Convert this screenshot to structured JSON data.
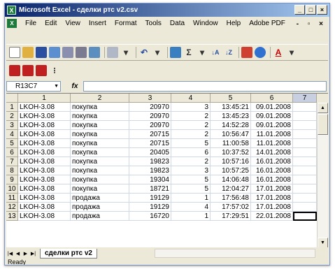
{
  "window": {
    "title": "Microsoft Excel - сделки ртс v2.csv",
    "controls": [
      "_",
      "□",
      "×"
    ]
  },
  "menu": {
    "items": [
      "File",
      "Edit",
      "View",
      "Insert",
      "Format",
      "Tools",
      "Data",
      "Window",
      "Help",
      "Adobe PDF"
    ]
  },
  "formula_bar": {
    "name_box": "R13C7",
    "fx_label": "fx",
    "content": ""
  },
  "columns": [
    "1",
    "2",
    "3",
    "4",
    "5",
    "6",
    "7"
  ],
  "rows": [
    {
      "n": "1",
      "c1": "LKOH-3.08",
      "c2": "покупка",
      "c3": "20970",
      "c4": "3",
      "c5": "13:45:21",
      "c6": "09.01.2008"
    },
    {
      "n": "2",
      "c1": "LKOH-3.08",
      "c2": "покупка",
      "c3": "20970",
      "c4": "2",
      "c5": "13:45:23",
      "c6": "09.01.2008"
    },
    {
      "n": "3",
      "c1": "LKOH-3.08",
      "c2": "покупка",
      "c3": "20970",
      "c4": "2",
      "c5": "14:52:28",
      "c6": "09.01.2008"
    },
    {
      "n": "4",
      "c1": "LKOH-3.08",
      "c2": "покупка",
      "c3": "20715",
      "c4": "2",
      "c5": "10:56:47",
      "c6": "11.01.2008"
    },
    {
      "n": "5",
      "c1": "LKOH-3.08",
      "c2": "покупка",
      "c3": "20715",
      "c4": "5",
      "c5": "11:00:58",
      "c6": "11.01.2008"
    },
    {
      "n": "6",
      "c1": "LKOH-3.08",
      "c2": "покупка",
      "c3": "20405",
      "c4": "6",
      "c5": "10:37:52",
      "c6": "14.01.2008"
    },
    {
      "n": "7",
      "c1": "LKOH-3.08",
      "c2": "покупка",
      "c3": "19823",
      "c4": "2",
      "c5": "10:57:16",
      "c6": "16.01.2008"
    },
    {
      "n": "8",
      "c1": "LKOH-3.08",
      "c2": "покупка",
      "c3": "19823",
      "c4": "3",
      "c5": "10:57:25",
      "c6": "16.01.2008"
    },
    {
      "n": "9",
      "c1": "LKOH-3.08",
      "c2": "покупка",
      "c3": "19304",
      "c4": "5",
      "c5": "14:06:48",
      "c6": "16.01.2008"
    },
    {
      "n": "10",
      "c1": "LKOH-3.08",
      "c2": "покупка",
      "c3": "18721",
      "c4": "5",
      "c5": "12:04:27",
      "c6": "17.01.2008"
    },
    {
      "n": "11",
      "c1": "LKOH-3.08",
      "c2": "продажа",
      "c3": "19129",
      "c4": "1",
      "c5": "17:56:48",
      "c6": "17.01.2008"
    },
    {
      "n": "12",
      "c1": "LKOH-3.08",
      "c2": "продажа",
      "c3": "19129",
      "c4": "4",
      "c5": "17:57:02",
      "c6": "17.01.2008"
    },
    {
      "n": "13",
      "c1": "LKOH-3.08",
      "c2": "продажа",
      "c3": "16720",
      "c4": "1",
      "c5": "17:29:51",
      "c6": "22.01.2008"
    }
  ],
  "sheet_tab": "сделки ртс v2",
  "status": "Ready",
  "colors": {
    "title_start": "#0a246a",
    "title_end": "#a6caf0",
    "chrome": "#ece9d8",
    "excel_green": "#1d7a3a"
  }
}
